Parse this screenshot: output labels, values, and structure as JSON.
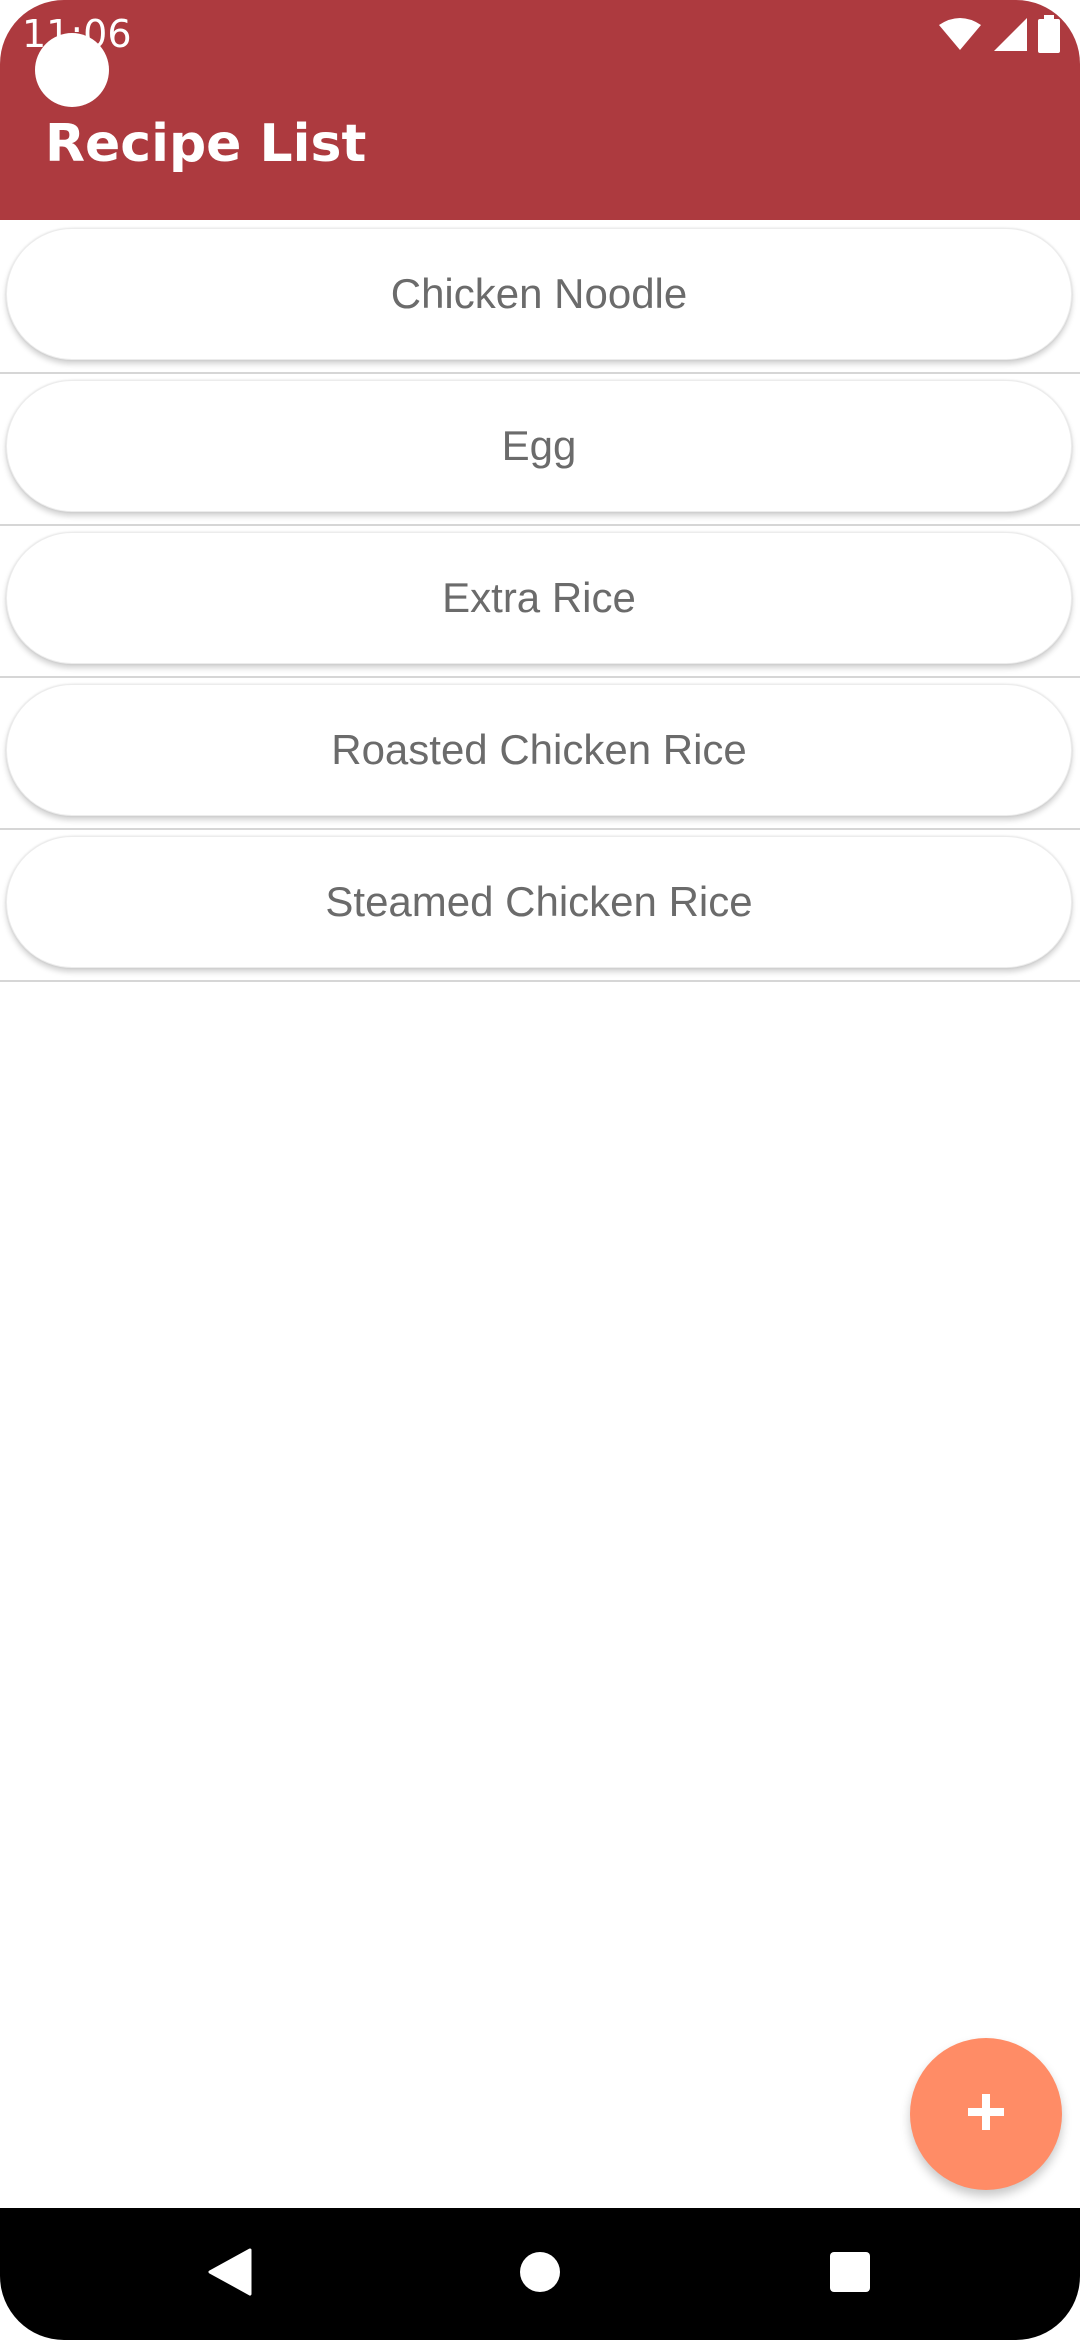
{
  "status_bar": {
    "time": "11:06"
  },
  "header": {
    "title": "Recipe List"
  },
  "recipes": [
    {
      "label": "Chicken Noodle"
    },
    {
      "label": "Egg"
    },
    {
      "label": "Extra Rice"
    },
    {
      "label": "Roasted Chicken Rice"
    },
    {
      "label": "Steamed Chicken Rice"
    }
  ],
  "fab": {
    "icon": "plus-icon"
  },
  "nav_bar": {
    "icons": [
      "back-icon",
      "home-icon",
      "recents-icon"
    ]
  },
  "colors": {
    "header": "#ad3a3f",
    "fab": "#ff8c66",
    "recipe_text": "#6b6b6b"
  }
}
